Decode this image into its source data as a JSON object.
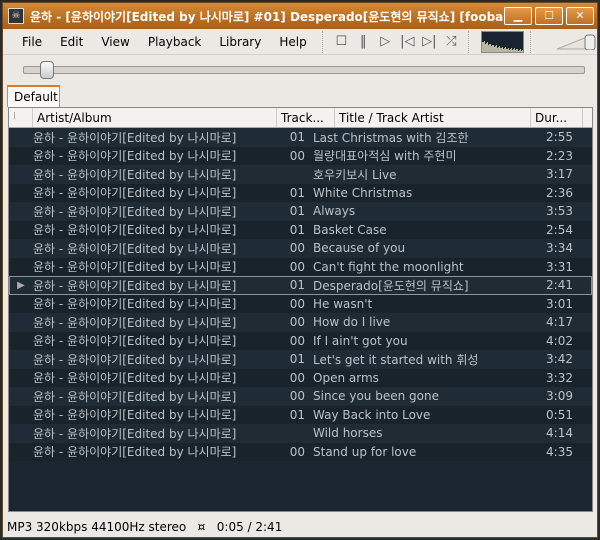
{
  "window": {
    "title": "윤하 - [윤하이야기[Edited by 나시마로] #01] Desperado[윤도현의 뮤직쇼]  [fooba...",
    "minimize": "▁",
    "maximize": "☐",
    "close": "✕"
  },
  "menu": [
    "File",
    "Edit",
    "View",
    "Playback",
    "Library",
    "Help"
  ],
  "toolbar": [
    {
      "icon": "stop-icon",
      "glyph": "☐"
    },
    {
      "icon": "pause-icon",
      "glyph": "‖"
    },
    {
      "icon": "play-icon",
      "glyph": "▷"
    },
    {
      "icon": "previous-icon",
      "glyph": "|◁"
    },
    {
      "icon": "next-icon",
      "glyph": "▷|"
    },
    {
      "icon": "random-icon",
      "glyph": "⤮"
    }
  ],
  "seek": {
    "position_seconds": 5,
    "length_seconds": 161
  },
  "tabs": [
    "Default"
  ],
  "columns": [
    "I",
    "Artist/Album",
    "Track...",
    "Title / Track Artist",
    "Dur..."
  ],
  "rows": [
    [
      "",
      "윤하 - 윤하이야기[Edited by 나시마로]",
      "01",
      "Last Christmas with 김조한",
      "2:55"
    ],
    [
      "",
      "윤하 - 윤하이야기[Edited by 나시마로]",
      "00",
      "월량대표아적심 with 주현미",
      "2:23"
    ],
    [
      "",
      "윤하 - 윤하이야기[Edited by 나시마로]",
      "",
      "호우키보시 Live",
      "3:17"
    ],
    [
      "",
      "윤하 - 윤하이야기[Edited by 나시마로]",
      "01",
      "White Christmas",
      "2:36"
    ],
    [
      "",
      "윤하 - 윤하이야기[Edited by 나시마로]",
      "01",
      "Always",
      "3:53"
    ],
    [
      "",
      "윤하 - 윤하이야기[Edited by 나시마로]",
      "01",
      "Basket Case",
      "2:54"
    ],
    [
      "",
      "윤하 - 윤하이야기[Edited by 나시마로]",
      "00",
      "Because of you",
      "3:34"
    ],
    [
      "",
      "윤하 - 윤하이야기[Edited by 나시마로]",
      "00",
      "Can't fight the moonlight",
      "3:31"
    ],
    [
      "▶",
      "윤하 - 윤하이야기[Edited by 나시마로]",
      "01",
      "Desperado[윤도현의 뮤직쇼]",
      "2:41"
    ],
    [
      "",
      "윤하 - 윤하이야기[Edited by 나시마로]",
      "00",
      "He wasn't",
      "3:01"
    ],
    [
      "",
      "윤하 - 윤하이야기[Edited by 나시마로]",
      "00",
      "How do I live",
      "4:17"
    ],
    [
      "",
      "윤하 - 윤하이야기[Edited by 나시마로]",
      "00",
      "If I ain't got you",
      "4:02"
    ],
    [
      "",
      "윤하 - 윤하이야기[Edited by 나시마로]",
      "01",
      "Let's get it started with 휘성",
      "3:42"
    ],
    [
      "",
      "윤하 - 윤하이야기[Edited by 나시마로]",
      "00",
      "Open arms",
      "3:32"
    ],
    [
      "",
      "윤하 - 윤하이야기[Edited by 나시마로]",
      "00",
      "Since you been gone",
      "3:09"
    ],
    [
      "",
      "윤하 - 윤하이야기[Edited by 나시마로]",
      "01",
      "Way Back into Love",
      "0:51"
    ],
    [
      "",
      "윤하 - 윤하이야기[Edited by 나시마로]",
      "",
      "Wild horses",
      "4:14"
    ],
    [
      "",
      "윤하 - 윤하이야기[Edited by 나시마로]",
      "00",
      "Stand up for love",
      "4:35"
    ]
  ],
  "current_row": 8,
  "status": "MP3 320kbps 44100Hz stereo   ¤   0:05 / 2:41",
  "colors": {
    "title_bar": "#b86e22",
    "playlist_bg": "#1c2630",
    "accent": "#e07820"
  }
}
